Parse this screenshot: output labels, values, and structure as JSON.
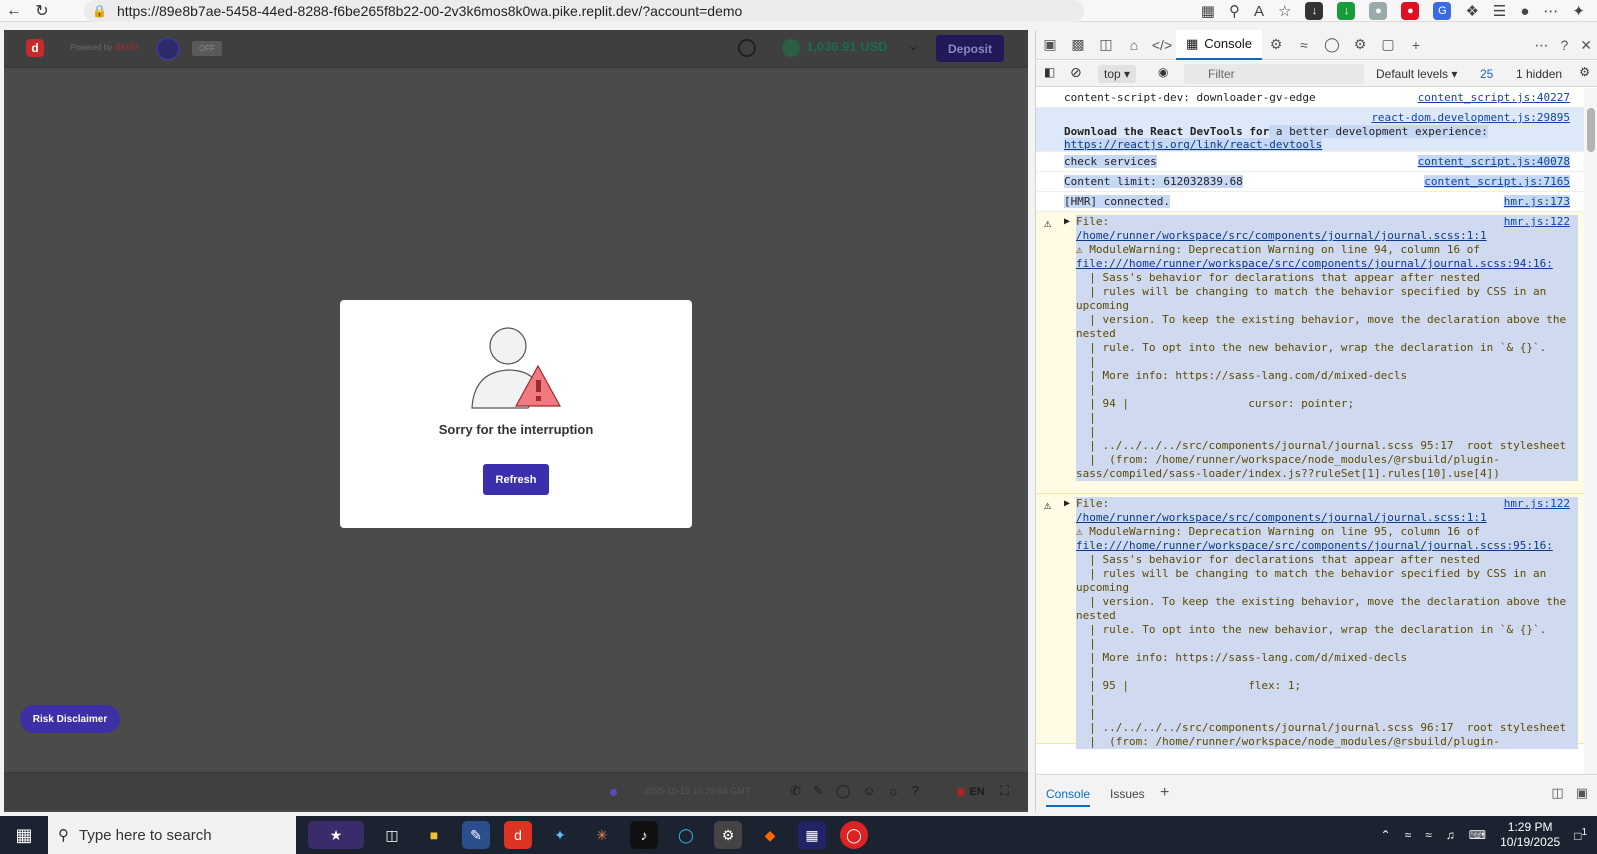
{
  "browser": {
    "url": "https://89e8b7ae-5458-44ed-8288-f6be265f8b22-00-2v3k6mos8k0wa.pike.replit.dev/?account=demo"
  },
  "app": {
    "powered_by": "Powered by",
    "brand": "deriv",
    "toggle_label": "OFF",
    "balance": "1,036.91 USD",
    "deposit_label": "Deposit",
    "dialog_message": "Sorry for the interruption",
    "refresh_label": "Refresh",
    "risk_label": "Risk Disclaimer",
    "footer_time": "2025-10-19 10:29:04 GMT",
    "language": "EN"
  },
  "devtools": {
    "console_tab": "Console",
    "context": "top",
    "filter_placeholder": "Filter",
    "levels": "Default levels",
    "message_count": "25",
    "hidden": "1 hidden",
    "rows": [
      {
        "text": "content-script-dev: downloader-gv-edge",
        "src": "content_script.js:40227"
      },
      {
        "text": "react-dom.development.js:29895",
        "src": ""
      },
      {
        "text": "check services",
        "src": "content_script.js:40078"
      },
      {
        "text": "Content limit: 612032839.68",
        "src": "content_script.js:7165"
      },
      {
        "text": "[HMR] connected.",
        "src": "hmr.js:173"
      }
    ],
    "react_msg_bold": "Download the React DevTools for",
    "react_msg_rest": " a better development experience:",
    "react_link": "https://reactjs.org/link/react-devtools",
    "warn1_src": "hmr.js:122",
    "warn2_src": "hmr.js:122",
    "warn1_head": "File:",
    "warn1_path": "/home/runner/workspace/src/components/journal/journal.scss:1:1",
    "warn1_line1": "⚠ ModuleWarning: Deprecation Warning on line 94, column 16 of",
    "warn1_fileurl": "file:///home/runner/workspace/src/components/journal/journal.scss:94:16:",
    "warn1_body": "  | Sass's behavior for declarations that appear after nested\n  | rules will be changing to match the behavior specified by CSS in an upcoming\n  | version. To keep the existing behavior, move the declaration above the nested\n  | rule. To opt into the new behavior, wrap the declaration in `& {}`.\n  |\n  | More info: https://sass-lang.com/d/mixed-decls\n  |\n  | 94 |                  cursor: pointer;\n  |\n  |\n  | ../../../../src/components/journal/journal.scss 95:17  root stylesheet\n  |  (from: /home/runner/workspace/node_modules/@rsbuild/plugin-sass/compiled/sass-loader/index.js??ruleSet[1].rules[10].use[4])",
    "warn2_line1": "⚠ ModuleWarning: Deprecation Warning on line 95, column 16 of",
    "warn2_fileurl": "file:///home/runner/workspace/src/components/journal/journal.scss:95:16:",
    "warn2_body": "  | Sass's behavior for declarations that appear after nested\n  | rules will be changing to match the behavior specified by CSS in an upcoming\n  | version. To keep the existing behavior, move the declaration above the nested\n  | rule. To opt into the new behavior, wrap the declaration in `& {}`.\n  |\n  | More info: https://sass-lang.com/d/mixed-decls\n  |\n  | 95 |                  flex: 1;\n  |\n  |\n  | ../../../../src/components/journal/journal.scss 96:17  root stylesheet\n  |  (from: /home/runner/workspace/node_modules/@rsbuild/plugin-",
    "bottom_console": "Console",
    "bottom_issues": "Issues"
  },
  "taskbar": {
    "search_placeholder": "Type here to search",
    "time": "1:29 PM",
    "date": "10/19/2025",
    "notifications": "1"
  }
}
